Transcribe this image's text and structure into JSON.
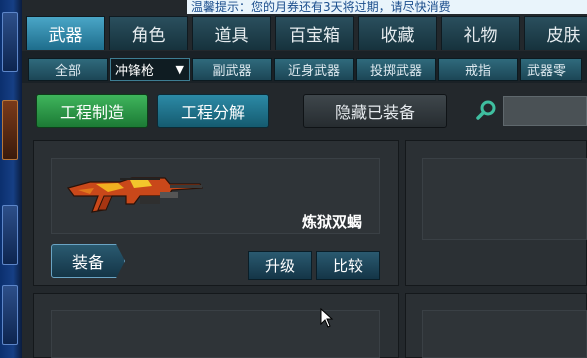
{
  "notice": {
    "text": "温馨提示：您的月券还有3天将过期，请尽快消费"
  },
  "tabs": [
    {
      "label": "武器",
      "active": true
    },
    {
      "label": "角色",
      "active": false
    },
    {
      "label": "道具",
      "active": false
    },
    {
      "label": "百宝箱",
      "active": false
    },
    {
      "label": "收藏",
      "active": false
    },
    {
      "label": "礼物",
      "active": false
    },
    {
      "label": "皮肤",
      "active": false
    }
  ],
  "subtabs": {
    "all": "全部",
    "filter_select": "冲锋枪",
    "secondary": "副武器",
    "melee": "近身武器",
    "throwing": "投掷武器",
    "ring": "戒指",
    "parts": "武器零"
  },
  "actions": {
    "craft": "工程制造",
    "decompose": "工程分解",
    "hide_equipped": "隐藏已装备"
  },
  "search": {
    "placeholder": ""
  },
  "item": {
    "name": "炼狱双蝎",
    "equip_label": "装备",
    "upgrade_label": "升级",
    "compare_label": "比较"
  },
  "colors": {
    "tab_active": "#2d8fb4",
    "craft_button": "#2a9a47",
    "notice_bg": "#e9f4fb"
  }
}
